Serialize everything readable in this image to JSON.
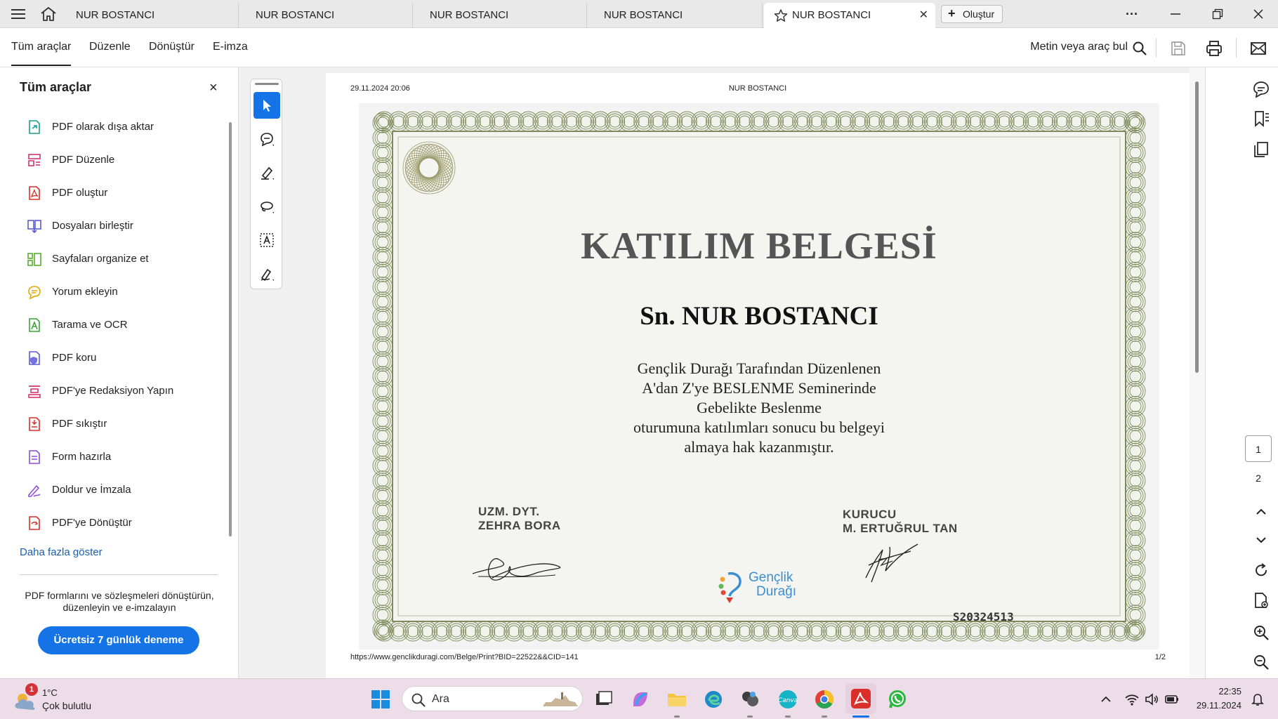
{
  "tabs": [
    {
      "label": "NUR BOSTANCI"
    },
    {
      "label": "NUR BOSTANCI"
    },
    {
      "label": "NUR BOSTANCI"
    },
    {
      "label": "NUR BOSTANCI"
    },
    {
      "label": "NUR BOSTANCI",
      "active": true
    }
  ],
  "titlebar": {
    "new_label": "Oluştur",
    "close_glyph": "✕",
    "more_glyph": "···"
  },
  "menu": {
    "items": [
      "Tüm araçlar",
      "Düzenle",
      "Dönüştür",
      "E-imza"
    ],
    "find_label": "Metin veya araç bul"
  },
  "left_panel": {
    "title": "Tüm araçlar",
    "items": [
      {
        "label": "PDF olarak dışa aktar",
        "icon": "export-pdf-icon",
        "color": "#1a9e8f"
      },
      {
        "label": "PDF Düzenle",
        "icon": "edit-pdf-icon",
        "color": "#d4376e"
      },
      {
        "label": "PDF oluştur",
        "icon": "create-pdf-icon",
        "color": "#d9302c"
      },
      {
        "label": "Dosyaları birleştir",
        "icon": "combine-files-icon",
        "color": "#5b5bd6"
      },
      {
        "label": "Sayfaları organize et",
        "icon": "organize-pages-icon",
        "color": "#5aaa2e"
      },
      {
        "label": "Yorum ekleyin",
        "icon": "comment-icon",
        "color": "#e0a800"
      },
      {
        "label": "Tarama ve OCR",
        "icon": "scan-ocr-icon",
        "color": "#3aa335"
      },
      {
        "label": "PDF koru",
        "icon": "protect-pdf-icon",
        "color": "#5b5bd6"
      },
      {
        "label": "PDF'ye Redaksiyon Yapın",
        "icon": "redact-icon",
        "color": "#d4376e"
      },
      {
        "label": "PDF sıkıştır",
        "icon": "compress-pdf-icon",
        "color": "#d9302c"
      },
      {
        "label": "Form hazırla",
        "icon": "prepare-form-icon",
        "color": "#8d4fd6"
      },
      {
        "label": "Doldur ve İmzala",
        "icon": "fill-sign-icon",
        "color": "#8d4fd6"
      },
      {
        "label": "PDF'ye Dönüştür",
        "icon": "convert-pdf-icon",
        "color": "#d9302c"
      }
    ],
    "more_label": "Daha fazla göster",
    "promo_text": "PDF formlarını ve sözleşmeleri dönüştürün, düzenleyin ve e-imzalayın",
    "trial_button": "Ücretsiz 7 günlük deneme"
  },
  "document": {
    "print_date": "29.11.2024 20:06",
    "header_title": "NUR BOSTANCI",
    "footer_url": "https://www.genclikduragi.com/Belge/Print?BID=22522&&CID=141",
    "page_indicator": "1/2",
    "certificate": {
      "title": "KATILIM BELGESİ",
      "recipient": "Sn. NUR BOSTANCI",
      "body_lines": [
        "Gençlik Durağı Tarafından Düzenlenen",
        "A'dan Z'ye BESLENME Seminerinde",
        "Gebelikte Beslenme",
        "oturumuna katılımları sonucu bu belgeyi",
        "almaya hak kazanmıştır."
      ],
      "left_signer_title": "UZM. DYT.",
      "left_signer_name": "ZEHRA BORA",
      "right_signer_title": "KURUCU",
      "right_signer_name": "M. ERTUĞRUL TAN",
      "logo_line1": "Gençlik",
      "logo_line2": "Durağı",
      "code": "S20324513",
      "frame_color": "#7d8a5a"
    }
  },
  "page_nav": {
    "pages": [
      "1",
      "2"
    ],
    "current": "1"
  },
  "taskbar": {
    "weather_temp": "1°C",
    "weather_desc": "Çok bulutlu",
    "weather_badge": "1",
    "search_placeholder": "Ara",
    "time": "22:35",
    "date": "29.11.2024"
  },
  "colors": {
    "accent": "#1473e6",
    "taskbar_bg": "#ecdde9",
    "acrobat_red": "#d9302c"
  }
}
